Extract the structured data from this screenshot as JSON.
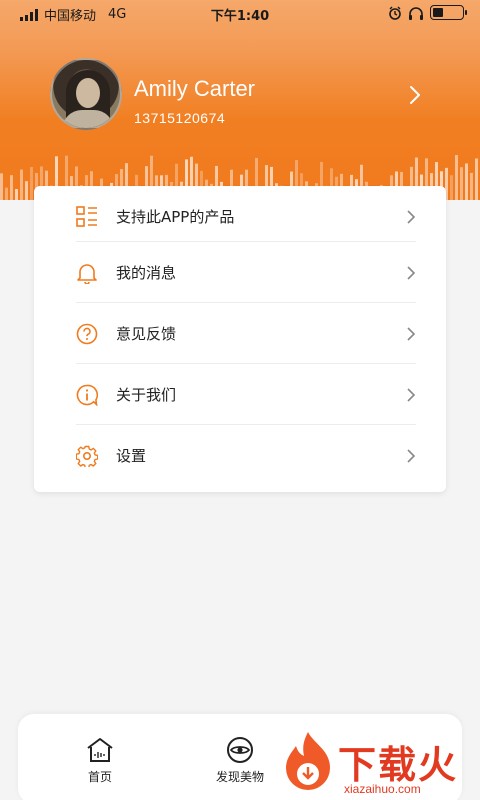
{
  "status_bar": {
    "carrier": "中国移动",
    "network": "4G",
    "time": "下午1:40",
    "battery_level": 0.35
  },
  "profile": {
    "name": "Amily Carter",
    "phone": "13715120674"
  },
  "menu": {
    "items": [
      {
        "label": "支持此APP的产品",
        "icon": "grid-list-icon"
      },
      {
        "label": "我的消息",
        "icon": "bell-icon"
      },
      {
        "label": "意见反馈",
        "icon": "question-icon"
      },
      {
        "label": "关于我们",
        "icon": "info-icon"
      },
      {
        "label": "设置",
        "icon": "gear-icon"
      }
    ]
  },
  "tabbar": {
    "tabs": [
      {
        "label": "首页",
        "icon": "home-icon"
      },
      {
        "label": "发现美物",
        "icon": "eye-icon"
      }
    ]
  },
  "watermark": {
    "text": "下载火",
    "subtext": "xiazaihuo.com"
  },
  "colors": {
    "accent": "#f17a1d",
    "watermark": "#e23a20"
  }
}
